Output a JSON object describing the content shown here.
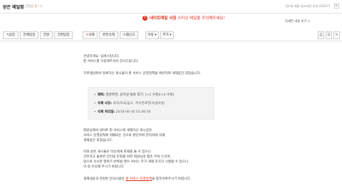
{
  "header": {
    "title": "받은 메일함",
    "unread_label": "안읽음",
    "unread_count": "2",
    "total": " / 3",
    "right_text": "(안내) 메일 임시저장 안내 (10/27)",
    "scroll_icon": "▸"
  },
  "notice": {
    "icon": "!",
    "strong": "네이트메일 사칭",
    "text": " 스미싱 메일을 주의해주세요!",
    "link": "자세한 내용 보기 >"
  },
  "toolbar": {
    "reply": "답장",
    "reply_all": "전체답장",
    "forward": "전달",
    "forward_simple": "간편답장",
    "delete": "삭제",
    "delete_perm": "완전삭제",
    "spam": "스팸신고",
    "move": "이동",
    "more": "추가",
    "print_icon": "⎙",
    "list_icon": "☰",
    "close_icon": "✕"
  },
  "mail": {
    "greeting": "안녕하세요. 넘게시입니다.",
    "thanks": "판 서비스를 이용해주셔서 감사드립니다.",
    "intro": "코르엣님께서 등록하신 게시물이 판 서비스 운영정책을 위반하여 게재중단 되었습니다.",
    "info": {
      "title_label": "제목:",
      "title_value": "말끝르면, 윤지성 탈락 후기. (+1 수정)(+2 수정)",
      "reason_label": "삭제 사유:",
      "reason_value": "욕막/모욕/음오, 저속한표현(욕설비방)",
      "date_label": "삭제 처리일:",
      "date_value": "2018-06-30 01:46:04"
    },
    "para1": [
      "회원님께서 네이트 판 서비스에 게재하신 게시글은",
      "서비스 운영원칙에 위배되는 것으로 판단하여 관리자에 의해",
      "게재중단 되었습니다."
    ],
    "para2": [
      "이와 같은 게시물은 타인에게 피해를 줄 수 있으니",
      "건전하고 올바른 인터넷 문화를 위한 회원님의 협조 부탁 드리며,",
      "앞으로 유사한 행위가 반복될 경우 서비스 추가 게재 조치가 시행될 수 있으니",
      "이 점 유의해 주시기 바랍니다."
    ],
    "footer_pre": "게재내용과 관련된 문의사항은 ",
    "footer_link": "판 서비스 운영정책",
    "footer_post": "을 참조하여주시기 바랍니다."
  }
}
